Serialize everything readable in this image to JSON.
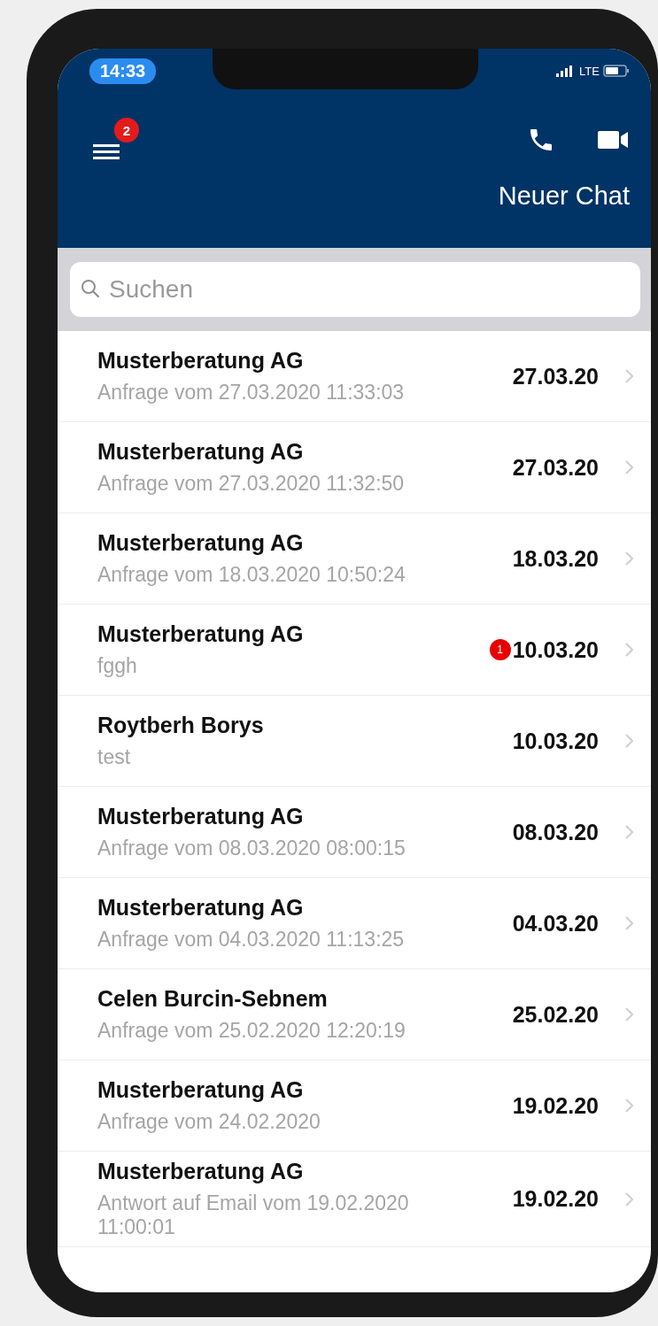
{
  "status_bar": {
    "time": "14:33",
    "network": "LTE"
  },
  "header": {
    "menu_badge": "2",
    "new_chat": "Neuer Chat"
  },
  "search": {
    "placeholder": "Suchen"
  },
  "chats": [
    {
      "name": "Musterberatung AG",
      "preview": "Anfrage vom 27.03.2020 11:33:03",
      "date": "27.03.20"
    },
    {
      "name": "Musterberatung AG",
      "preview": "Anfrage vom 27.03.2020 11:32:50",
      "date": "27.03.20"
    },
    {
      "name": "Musterberatung AG",
      "preview": "Anfrage vom 18.03.2020 10:50:24",
      "date": "18.03.20"
    },
    {
      "name": "Musterberatung AG",
      "preview": "fggh",
      "date": "10.03.20",
      "unread": "1"
    },
    {
      "name": "Roytberh Borys",
      "preview": "test",
      "date": "10.03.20"
    },
    {
      "name": "Musterberatung AG",
      "preview": "Anfrage vom 08.03.2020 08:00:15",
      "date": "08.03.20"
    },
    {
      "name": "Musterberatung AG",
      "preview": "Anfrage vom 04.03.2020 11:13:25",
      "date": "04.03.20"
    },
    {
      "name": "Celen Burcin-Sebnem",
      "preview": "Anfrage vom 25.02.2020 12:20:19",
      "date": "25.02.20"
    },
    {
      "name": "Musterberatung AG",
      "preview": "Anfrage vom 24.02.2020",
      "date": "19.02.20"
    },
    {
      "name": "Musterberatung AG",
      "preview": "Antwort auf Email vom 19.02.2020 11:00:01",
      "date": "19.02.20"
    }
  ]
}
